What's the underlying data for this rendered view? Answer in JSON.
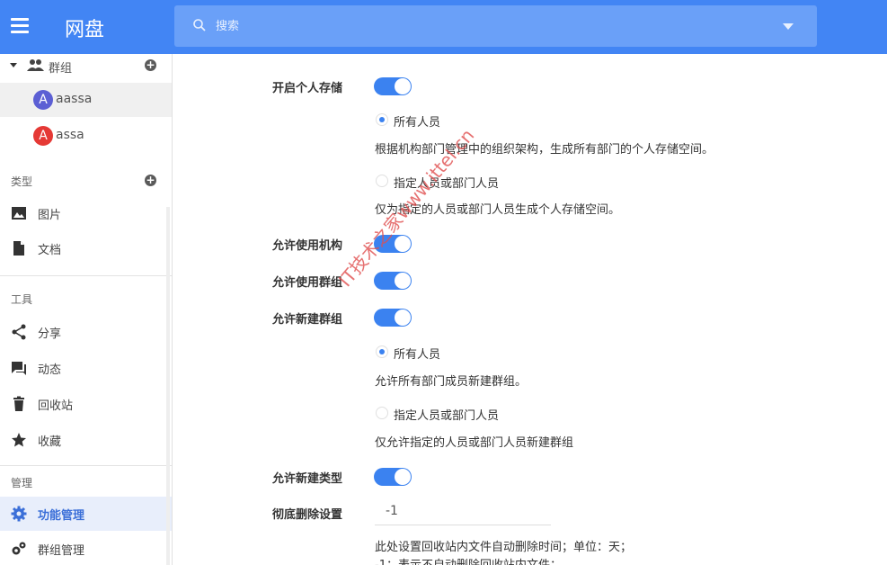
{
  "header": {
    "title": "网盘",
    "search_placeholder": "搜索"
  },
  "sidebar": {
    "group_section": "群组",
    "groups": [
      {
        "initial": "A",
        "name": "aassa",
        "color": "#5c5fd4"
      },
      {
        "initial": "A",
        "name": "assa",
        "color": "#e53935"
      }
    ],
    "types_section": "类型",
    "types": [
      {
        "label": "图片",
        "icon": "image-icon"
      },
      {
        "label": "文档",
        "icon": "document-icon"
      }
    ],
    "tools_section": "工具",
    "tools": [
      {
        "label": "分享",
        "icon": "share-icon"
      },
      {
        "label": "动态",
        "icon": "activity-icon"
      },
      {
        "label": "回收站",
        "icon": "trash-icon"
      },
      {
        "label": "收藏",
        "icon": "star-icon"
      }
    ],
    "manage_section": "管理",
    "manage": [
      {
        "label": "功能管理",
        "icon": "gear-icon"
      },
      {
        "label": "群组管理",
        "icon": "group-settings-icon"
      }
    ]
  },
  "settings": {
    "personal_storage": {
      "label": "开启个人存储",
      "enabled": true,
      "option_all": "所有人员",
      "option_all_desc": "根据机构部门管理中的组织架构，生成所有部门的个人存储空间。",
      "option_specific": "指定人员或部门人员",
      "option_specific_desc": "仅为指定的人员或部门人员生成个人存储空间。"
    },
    "allow_org": {
      "label": "允许使用机构",
      "enabled": true
    },
    "allow_group": {
      "label": "允许使用群组",
      "enabled": true
    },
    "allow_new_group": {
      "label": "允许新建群组",
      "enabled": true,
      "option_all": "所有人员",
      "option_all_desc": "允许所有部门成员新建群组。",
      "option_specific": "指定人员或部门人员",
      "option_specific_desc": "仅允许指定的人员或部门人员新建群组"
    },
    "allow_new_type": {
      "label": "允许新建类型",
      "enabled": true
    },
    "purge": {
      "label": "彻底删除设置",
      "value": "-1",
      "desc1": "此处设置回收站内文件自动删除时间；单位：天；",
      "desc2": "-1：表示不自动删除回收站内文件；"
    }
  },
  "watermark": "IT技术之家www.ittel.cn",
  "colors": {
    "primary": "#4285f4",
    "toggle": "#3b82f0"
  }
}
